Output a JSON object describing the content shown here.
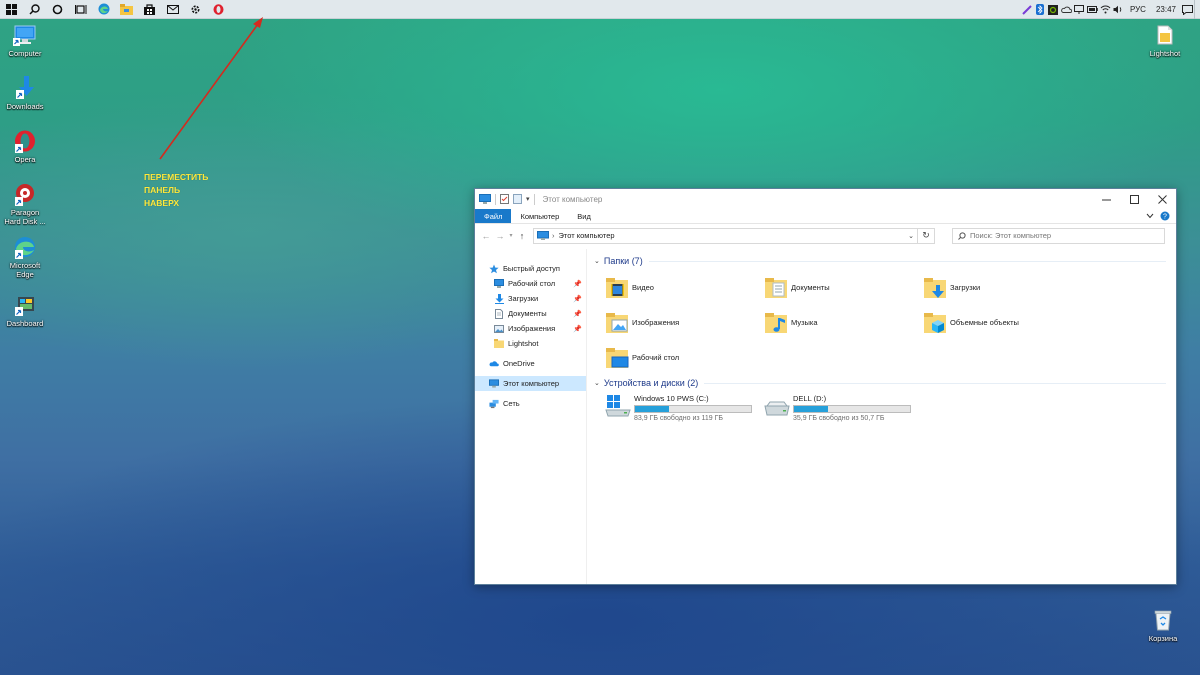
{
  "taskbar": {
    "items": [
      {
        "icon": "windows-start-icon"
      },
      {
        "icon": "search-icon"
      },
      {
        "icon": "cortana-icon"
      },
      {
        "icon": "task-view-icon"
      },
      {
        "icon": "edge-icon"
      },
      {
        "icon": "file-explorer-icon"
      },
      {
        "icon": "store-icon"
      },
      {
        "icon": "mail-icon"
      },
      {
        "icon": "settings-icon"
      },
      {
        "icon": "opera-icon"
      }
    ],
    "tray": {
      "language": "РУС",
      "time": "23:47"
    }
  },
  "desktop": {
    "icons_left": [
      {
        "label": "Computer",
        "icon": "computer-icon"
      },
      {
        "label": "Downloads",
        "icon": "downloads-icon"
      },
      {
        "label": "Opera",
        "icon": "opera-icon"
      },
      {
        "label": "Paragon Hard Disk ...",
        "icon": "paragon-icon"
      },
      {
        "label": "Microsoft Edge",
        "icon": "edge-icon"
      },
      {
        "label": "Dashboard",
        "icon": "dashboard-icon"
      }
    ],
    "icons_right": [
      {
        "label": "Lightshot",
        "icon": "lightshot-icon"
      },
      {
        "label": "Корзина",
        "icon": "recycle-bin-icon"
      }
    ],
    "annotation": [
      "ПЕРЕМЕСТИТЬ",
      "ПАНЕЛЬ",
      "НАВЕРХ"
    ]
  },
  "explorer": {
    "title": "Этот компьютер",
    "ribbon_tabs": [
      "Файл",
      "Компьютер",
      "Вид"
    ],
    "address": "Этот компьютер",
    "search_placeholder": "Поиск: Этот компьютер",
    "nav": {
      "quick_access": "Быстрый доступ",
      "pinned": [
        {
          "label": "Рабочий стол",
          "icon": "desktop-folder-icon",
          "pinned": true
        },
        {
          "label": "Загрузки",
          "icon": "downloads-arrow-icon",
          "pinned": true
        },
        {
          "label": "Документы",
          "icon": "documents-icon",
          "pinned": true
        },
        {
          "label": "Изображения",
          "icon": "pictures-icon",
          "pinned": true
        },
        {
          "label": "Lightshot",
          "icon": "folder-icon",
          "pinned": false
        }
      ],
      "onedrive": "OneDrive",
      "this_pc": "Этот компьютер",
      "network": "Сеть"
    },
    "folders_header": "Папки (7)",
    "folders": [
      {
        "name": "Видео",
        "icon": "video-folder-icon"
      },
      {
        "name": "Документы",
        "icon": "documents-folder-icon"
      },
      {
        "name": "Загрузки",
        "icon": "downloads-folder-icon"
      },
      {
        "name": "Изображения",
        "icon": "pictures-folder-icon"
      },
      {
        "name": "Музыка",
        "icon": "music-folder-icon"
      },
      {
        "name": "Объемные объекты",
        "icon": "3d-objects-folder-icon"
      },
      {
        "name": "Рабочий стол",
        "icon": "desktop-folder-icon"
      }
    ],
    "drives_header": "Устройства и диски (2)",
    "drives": [
      {
        "name": "Windows 10 PWS (C:)",
        "free": "83,9 ГБ свободно из 119 ГБ",
        "used_fraction": 0.295,
        "icon": "windows-drive-icon"
      },
      {
        "name": "DELL (D:)",
        "free": "35,9 ГБ свободно из 50,7 ГБ",
        "used_fraction": 0.292,
        "icon": "hdd-drive-icon"
      }
    ]
  },
  "colors": {
    "accent": "#1979ca",
    "selection": "#cce8ff",
    "annotation": "#ffe93b",
    "arrow": "#d42a1e",
    "bar_fill": "#26a0da"
  }
}
